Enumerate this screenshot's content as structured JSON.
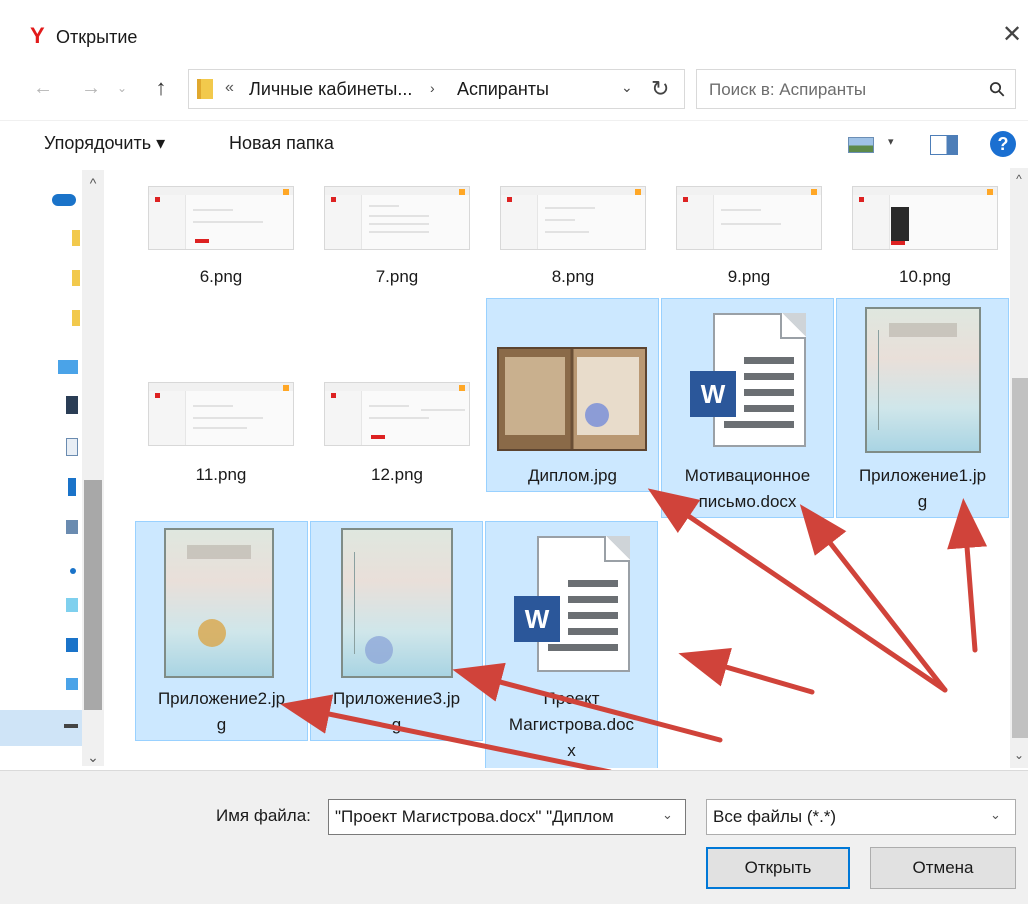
{
  "window": {
    "app_logo": "Y",
    "title": "Открытие",
    "close_glyph": "✕"
  },
  "nav": {
    "back_glyph": "←",
    "forward_glyph": "→",
    "recent_glyph": "⌄",
    "up_glyph": "↑",
    "address": {
      "prefix": "«",
      "crumbs": [
        "Личные кабинеты...",
        "Аспиранты"
      ],
      "separator": "›",
      "dropdown_glyph": "⌄",
      "refresh_glyph": "↻"
    },
    "search": {
      "placeholder": "Поиск в: Аспиранты",
      "icon_glyph": "⚲"
    }
  },
  "toolbar": {
    "organize_label": "Упорядочить ▾",
    "new_folder_label": "Новая папка",
    "view_caret": "▾",
    "help_glyph": "?"
  },
  "nav_pane": {
    "scroll_up": "^",
    "scroll_down": "⌄"
  },
  "files": [
    {
      "name": "6.png",
      "kind": "png-screenshot",
      "selected": false
    },
    {
      "name": "7.png",
      "kind": "png-screenshot",
      "selected": false
    },
    {
      "name": "8.png",
      "kind": "png-screenshot",
      "selected": false
    },
    {
      "name": "9.png",
      "kind": "png-screenshot",
      "selected": false
    },
    {
      "name": "10.png",
      "kind": "png-screenshot",
      "selected": false
    },
    {
      "name": "11.png",
      "kind": "png-screenshot",
      "selected": false
    },
    {
      "name": "12.png",
      "kind": "png-screenshot",
      "selected": false
    },
    {
      "name": "Диплом.jpg",
      "kind": "photo-diploma",
      "selected": true
    },
    {
      "name": "Мотивационное письмо.docx",
      "kind": "docx",
      "selected": true
    },
    {
      "name": "Приложение1.jpg",
      "kind": "photo-appendix",
      "selected": true
    },
    {
      "name": "Приложение2.jpg",
      "kind": "photo-appendix",
      "selected": true
    },
    {
      "name": "Приложение3.jpg",
      "kind": "photo-appendix",
      "selected": true
    },
    {
      "name": "Проект Магистрова.docx",
      "kind": "docx",
      "selected": true
    }
  ],
  "file_labels": {
    "f6": "6.png",
    "f7": "7.png",
    "f8": "8.png",
    "f9": "9.png",
    "f10": "10.png",
    "f11": "11.png",
    "f12": "12.png",
    "diplom_line1": "Диплом.jpg",
    "motiv_line1": "Мотивационное",
    "motiv_line2": "письмо.docx",
    "pril1_line1": "Приложение1.jp",
    "pril1_line2": "g",
    "pril2_line1": "Приложение2.jp",
    "pril2_line2": "g",
    "pril3_line1": "Приложение3.jp",
    "pril3_line2": "g",
    "proekt_line1": "Проект",
    "proekt_line2": "Магистрова.doc",
    "proekt_line3": "x",
    "word_letter": "W"
  },
  "footer": {
    "filename_label": "Имя файла:",
    "filename_value": "\"Проект Магистрова.docx\" \"Диплом",
    "filename_caret": "⌄",
    "filetype_value": "Все файлы (*.*)",
    "filetype_caret": "⌄",
    "open_label": "Открыть",
    "cancel_label": "Отмена"
  },
  "colors": {
    "selection_bg": "#cce8ff",
    "selection_border": "#99d1ff",
    "accent_blue": "#0078d7",
    "word_blue": "#2b579a",
    "annotation_red": "#d0433a"
  }
}
